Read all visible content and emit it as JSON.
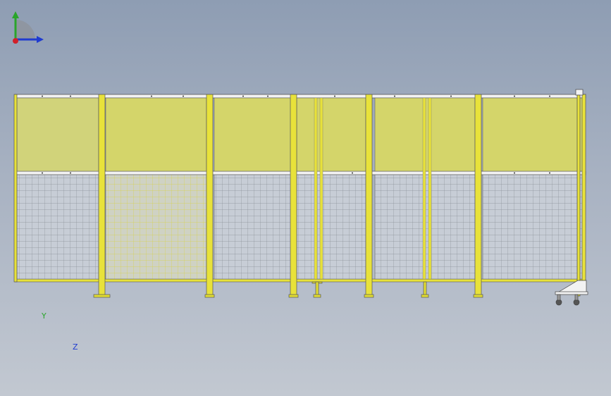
{
  "viewport": {
    "background_top": "#8e9db3",
    "background_bottom": "#c2c8d1"
  },
  "model": {
    "description_icon": "safety-fence-assembly",
    "panel_count": 6,
    "frame_color": "#e8e23a",
    "panel_fill_color": "#d4d56e",
    "top_rail_color": "#f2f2f2",
    "mesh_color": "#7b8087"
  },
  "triad": {
    "y_label": "Y",
    "z_label": "Z",
    "y_color": "#2aa52a",
    "z_color": "#1f3bd0",
    "x_color": "#d0202a"
  }
}
